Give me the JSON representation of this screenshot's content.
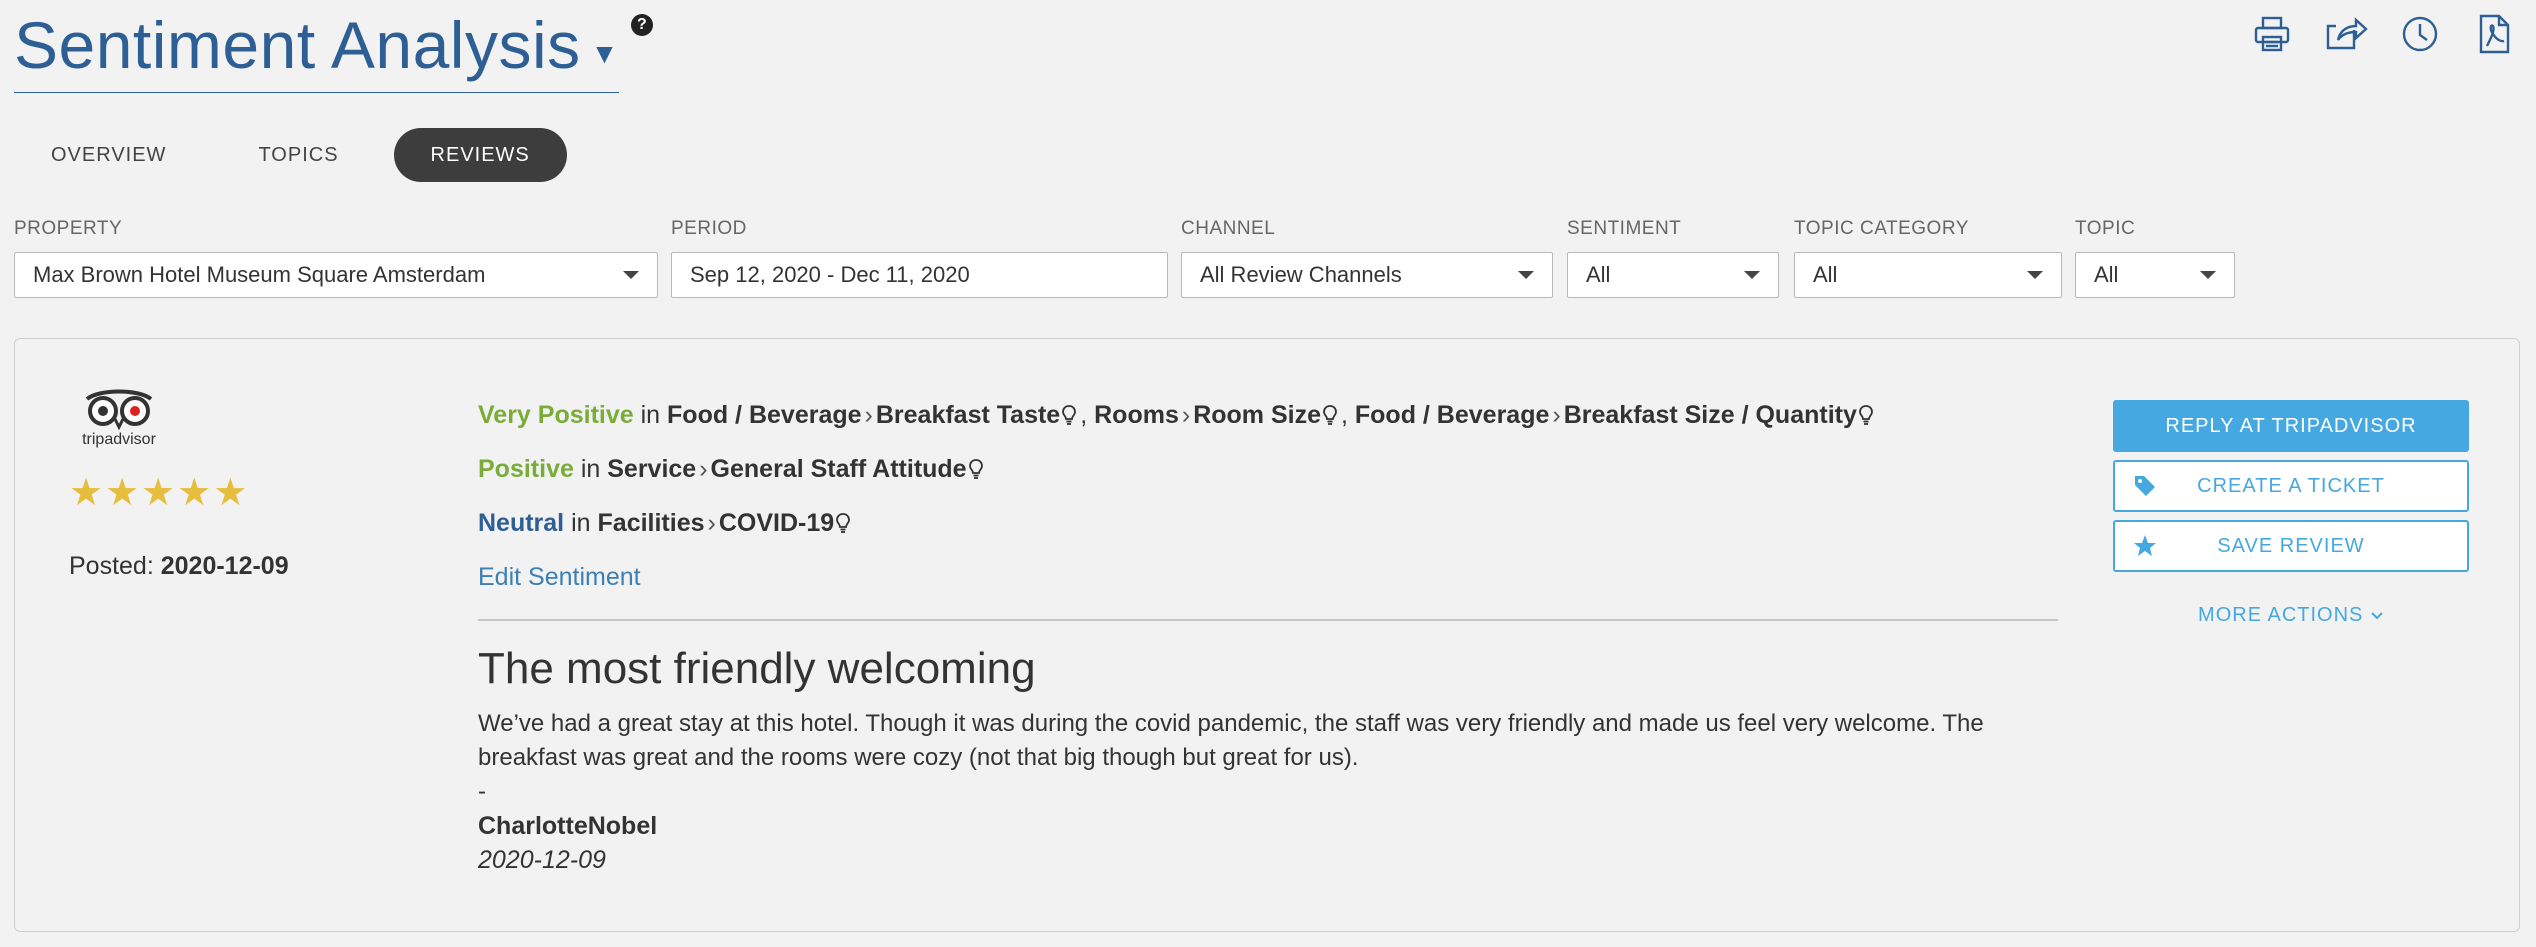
{
  "header": {
    "title": "Sentiment Analysis",
    "help": "?"
  },
  "toolbar_icons": [
    "print-icon",
    "share-icon",
    "history-icon",
    "pdf-icon"
  ],
  "tabs": [
    {
      "label": "OVERVIEW",
      "active": false
    },
    {
      "label": "TOPICS",
      "active": false
    },
    {
      "label": "REVIEWS",
      "active": true
    }
  ],
  "filters": {
    "property": {
      "label": "PROPERTY",
      "value": "Max Brown Hotel Museum Square Amsterdam"
    },
    "period": {
      "label": "PERIOD",
      "value": "Sep 12, 2020 - Dec 11, 2020"
    },
    "channel": {
      "label": "CHANNEL",
      "value": "All Review Channels"
    },
    "sentiment": {
      "label": "SENTIMENT",
      "value": "All"
    },
    "topic_category": {
      "label": "TOPIC CATEGORY",
      "value": "All"
    },
    "topic": {
      "label": "TOPIC",
      "value": "All"
    }
  },
  "review": {
    "source_logo_text": "tripadvisor",
    "rating": 5,
    "posted_label": "Posted:",
    "posted_date": "2020-12-09",
    "sentiments": [
      {
        "level": "Very Positive",
        "in": "in",
        "topics": [
          {
            "category": "Food / Beverage",
            "topic": "Breakfast Taste"
          },
          {
            "category": "Rooms",
            "topic": "Room Size"
          },
          {
            "category": "Food / Beverage",
            "topic": "Breakfast Size / Quantity"
          }
        ]
      },
      {
        "level": "Positive",
        "in": "in",
        "topics": [
          {
            "category": "Service",
            "topic": "General Staff Attitude"
          }
        ]
      },
      {
        "level": "Neutral",
        "in": "in",
        "topics": [
          {
            "category": "Facilities",
            "topic": "COVID-19"
          }
        ]
      }
    ],
    "edit_sentiment": "Edit Sentiment",
    "title": "The most friendly welcoming",
    "body": "We’ve had a great stay at this hotel. Though it was during the covid pandemic, the staff was very friendly and made us feel very welcome. The breakfast was great and the rooms were cozy (not that big though but great for us).",
    "dash": "-",
    "author": "CharlotteNobel",
    "date": "2020-12-09"
  },
  "actions": {
    "reply": "REPLY AT TRIPADVISOR",
    "ticket": "CREATE A TICKET",
    "save": "SAVE REVIEW",
    "more": "MORE ACTIONS"
  },
  "colors": {
    "title_blue": "#2d5f95",
    "very_positive": "#7aac3a",
    "accent": "#45a8e0",
    "star": "#e6bd3d"
  }
}
